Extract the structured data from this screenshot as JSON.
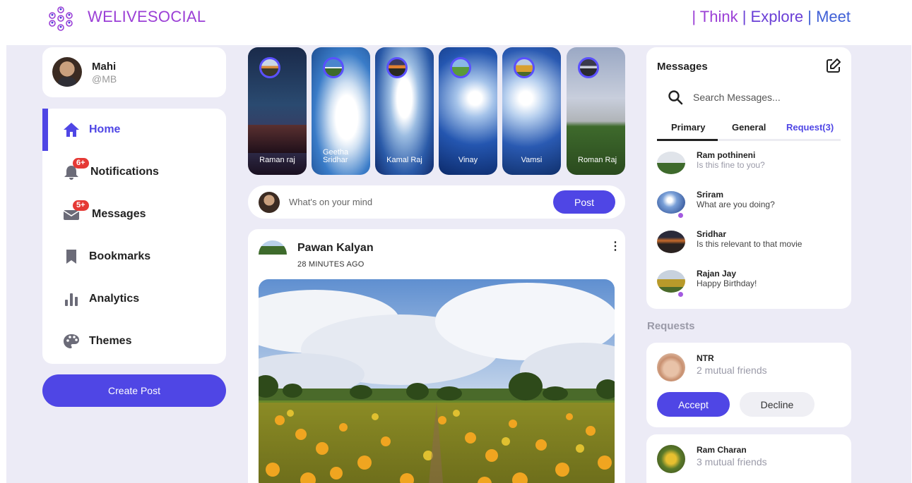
{
  "brand": {
    "name": "WELIVESOCIAL",
    "tagline_parts": [
      "| Think ",
      "| Explore ",
      "| Meet"
    ]
  },
  "profile": {
    "name": "Mahi",
    "handle": "@MB"
  },
  "nav": {
    "items": [
      {
        "label": "Home",
        "icon": "home-icon",
        "active": true
      },
      {
        "label": "Notifications",
        "icon": "bell-icon",
        "badge": "6+"
      },
      {
        "label": "Messages",
        "icon": "envelope-icon",
        "badge": "5+"
      },
      {
        "label": "Bookmarks",
        "icon": "bookmark-icon"
      },
      {
        "label": "Analytics",
        "icon": "bar-chart-icon"
      },
      {
        "label": "Themes",
        "icon": "palette-icon"
      }
    ],
    "create_post": "Create Post"
  },
  "stories": [
    {
      "name": "Raman raj"
    },
    {
      "name": "Geetha Sridhar"
    },
    {
      "name": "Kamal Raj"
    },
    {
      "name": "Vinay"
    },
    {
      "name": "Vamsi"
    },
    {
      "name": "Roman Raj"
    }
  ],
  "composer": {
    "placeholder": "What's on your mind",
    "post_label": "Post"
  },
  "feed": {
    "author": "Pawan Kalyan",
    "time": "28 MINUTES AGO",
    "more": "⋮"
  },
  "messages": {
    "title": "Messages",
    "search_placeholder": "Search Messages...",
    "tabs": [
      "Primary",
      "General",
      "Request(3)"
    ],
    "list": [
      {
        "name": "Ram pothineni",
        "text": "Is this fine to you?",
        "online": false,
        "faded": true
      },
      {
        "name": "Sriram",
        "text": "What are you doing?",
        "online": true,
        "faded": false
      },
      {
        "name": "Sridhar",
        "text": "Is this relevant to that movie",
        "online": false,
        "faded": false
      },
      {
        "name": "Rajan Jay",
        "text": "Happy Birthday!",
        "online": true,
        "faded": false
      }
    ]
  },
  "requests": {
    "title": "Requests",
    "items": [
      {
        "name": "NTR",
        "mutual": "2 mutual friends",
        "accept": "Accept",
        "decline": "Decline"
      },
      {
        "name": "Ram Charan",
        "mutual": "3 mutual friends"
      }
    ]
  },
  "colors": {
    "accent": "#4f46e5",
    "brand": "#9b3fd6",
    "background": "#ecebf6",
    "badge": "#e53935"
  }
}
